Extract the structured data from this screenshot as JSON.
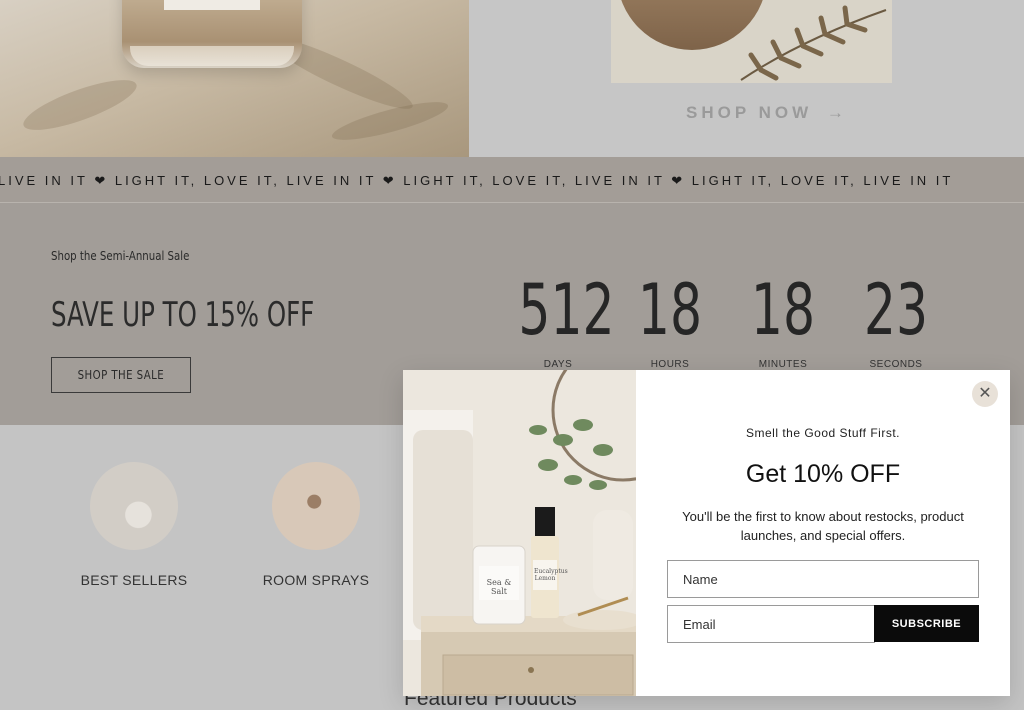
{
  "hero": {
    "shop_now_label": "SHOP NOW",
    "shop_now_arrow": "→"
  },
  "marquee": {
    "text": "LIVE IN IT ❤ LIGHT IT, LOVE IT, LIVE IN IT ❤ LIGHT IT, LOVE IT, LIVE IN IT ❤ LIGHT IT, LOVE IT, LIVE IN IT"
  },
  "sale": {
    "eyebrow": "Shop the Semi-Annual Sale",
    "title": "SAVE UP TO 15% OFF",
    "button_label": "SHOP THE SALE",
    "countdown": [
      {
        "value": "512",
        "unit": "DAYS"
      },
      {
        "value": "18",
        "unit": "HOURS"
      },
      {
        "value": "18",
        "unit": "MINUTES"
      },
      {
        "value": "23",
        "unit": "SECONDS"
      }
    ]
  },
  "categories": [
    {
      "label": "BEST SELLERS"
    },
    {
      "label": "ROOM SPRAYS"
    }
  ],
  "featured_heading": "Featured Products",
  "popup": {
    "close_icon": "close-icon",
    "eyebrow": "Smell the Good Stuff First.",
    "title": "Get 10% OFF",
    "description": "You'll be the first to know about restocks, product launches, and special offers.",
    "name_placeholder": "Name",
    "email_placeholder": "Email",
    "subscribe_label": "SUBSCRIBE",
    "product_labels": {
      "candle": "Sea & Salt",
      "spray": "Eucalyptus Lemon"
    }
  },
  "colors": {
    "sale_band": "#a29d98",
    "marquee": "#a39d97",
    "subscribe_button": "#0b0b0b",
    "close_button": "#e8e1d8"
  }
}
